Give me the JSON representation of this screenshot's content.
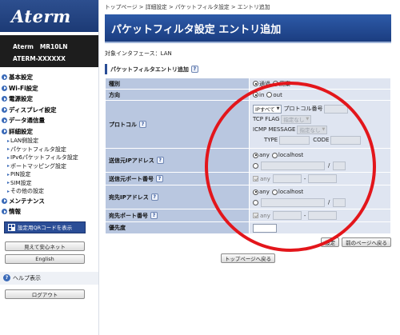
{
  "sidebar": {
    "logo": "Aterm",
    "model_line1": "Aterm   MR10LN",
    "model_line2": "ATERM-XXXXXX",
    "nav": [
      "基本設定",
      "Wi-Fi設定",
      "電源設定",
      "ディスプレイ設定",
      "データ通信量",
      "詳細設定"
    ],
    "sub_items": [
      "LAN側設定",
      "パケットフィルタ設定",
      "IPv6パケットフィルタ設定",
      "ポートマッピング設定",
      "PIN設定",
      "SIM設定",
      "その他の設定"
    ],
    "nav_after": [
      "メンテナンス",
      "情報"
    ],
    "qr_button": "設定用QRコードを表示",
    "btn_mieru": "見えて安心ネット",
    "btn_english": "English",
    "help": "ヘルプ表示",
    "logout": "ログアウト"
  },
  "breadcrumb": "トップページ > 詳細設定 > パケットフィルタ設定 > エントリ追加",
  "page_title": "パケットフィルタ設定 エントリ追加",
  "interface_label": "対象インタフェース：LAN",
  "section_title": "パケットフィルタエントリ追加",
  "form": {
    "type_label": "種別",
    "type_options": [
      "通過",
      "廃棄"
    ],
    "direction_label": "方向",
    "direction_options": [
      "in",
      "out"
    ],
    "protocol_label": "プロトコル",
    "protocol_select": "IPすべて",
    "protocol_number_label": "プロトコル番号",
    "tcp_flag_label": "TCP FLAG",
    "tcp_flag_value": "指定なし",
    "icmp_label": "ICMP MESSAGE",
    "icmp_value": "指定なし",
    "type_field_label": "TYPE",
    "code_field_label": "CODE",
    "src_ip_label": "送信元IPアドレス",
    "src_port_label": "送信元ポート番号",
    "dst_ip_label": "宛先IPアドレス",
    "dst_port_label": "宛先ポート番号",
    "ip_options": [
      "any",
      "localhost"
    ],
    "any_label": "any",
    "slash": "/",
    "dash": "-",
    "priority_label": "優先度"
  },
  "buttons": {
    "set": "設定",
    "back": "前のページへ戻る",
    "top": "トップページへ戻る"
  },
  "help_q": "?",
  "colors": {
    "header_blue": "#1b3d80",
    "label_blue": "#b9c7e0",
    "value_blue": "#dfe5f1",
    "highlight_red": "#e3161b"
  }
}
